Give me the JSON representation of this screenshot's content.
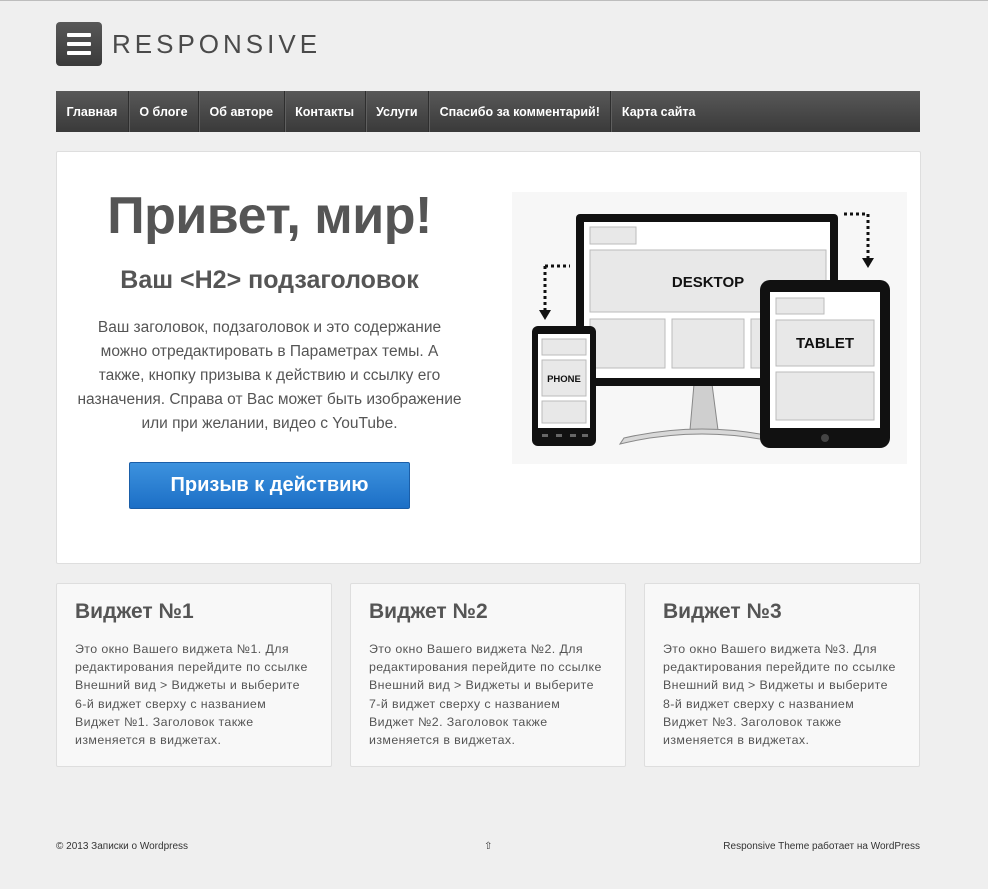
{
  "site": {
    "logo_text": "RESPONSIVE"
  },
  "menu": [
    "Главная",
    "О блоге",
    "Об авторе",
    "Контакты",
    "Услуги",
    "Спасибо за комментарий!",
    "Карта сайта"
  ],
  "hero": {
    "title": "Привет, мир!",
    "subtitle": "Ваш <H2> подзаголовок",
    "text": "Ваш заголовок, подзаголовок и это содержание можно отредактировать в Параметрах темы. А также, кнопку призыва к действию и ссылку его назначения. Справа от Вас может быть изображение или при желании, видео с YouTube.",
    "cta_label": "Призыв к действию",
    "image_labels": {
      "desktop": "DESKTOP",
      "tablet": "TABLET",
      "phone": "PHONE"
    }
  },
  "widgets": [
    {
      "title": "Виджет №1",
      "text": "Это окно Вашего виджета №1. Для редактирования перейдите по ссылке Внешний вид > Виджеты и выберите 6-й виджет сверху с названием Виджет №1. Заголовок также изменяется в виджетах."
    },
    {
      "title": "Виджет №2",
      "text": "Это окно Вашего виджета №2. Для редактирования перейдите по ссылке Внешний вид > Виджеты и выберите 7-й виджет сверху с названием Виджет №2. Заголовок также изменяется в виджетах."
    },
    {
      "title": "Виджет №3",
      "text": "Это окно Вашего виджета №3. Для редактирования перейдите по ссылке Внешний вид > Виджеты и выберите 8-й виджет сверху с названием Виджет №3. Заголовок также изменяется в виджетах."
    }
  ],
  "footer": {
    "copyright": "© 2013 Записки о Wordpress",
    "scroll_top": "⇧",
    "credit_theme": "Responsive Theme",
    "credit_text": " работает на ",
    "credit_wp": "WordPress"
  }
}
